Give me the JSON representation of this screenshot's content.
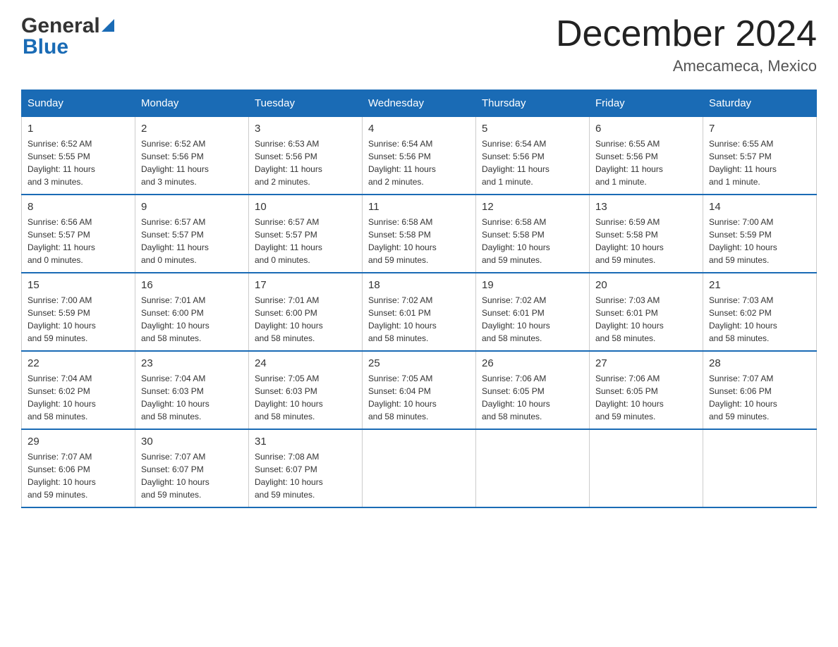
{
  "header": {
    "month_title": "December 2024",
    "location": "Amecameca, Mexico",
    "logo_general": "General",
    "logo_blue": "Blue"
  },
  "days_of_week": [
    "Sunday",
    "Monday",
    "Tuesday",
    "Wednesday",
    "Thursday",
    "Friday",
    "Saturday"
  ],
  "weeks": [
    [
      {
        "day": "1",
        "sunrise": "6:52 AM",
        "sunset": "5:55 PM",
        "daylight": "11 hours and 3 minutes."
      },
      {
        "day": "2",
        "sunrise": "6:52 AM",
        "sunset": "5:56 PM",
        "daylight": "11 hours and 3 minutes."
      },
      {
        "day": "3",
        "sunrise": "6:53 AM",
        "sunset": "5:56 PM",
        "daylight": "11 hours and 2 minutes."
      },
      {
        "day": "4",
        "sunrise": "6:54 AM",
        "sunset": "5:56 PM",
        "daylight": "11 hours and 2 minutes."
      },
      {
        "day": "5",
        "sunrise": "6:54 AM",
        "sunset": "5:56 PM",
        "daylight": "11 hours and 1 minute."
      },
      {
        "day": "6",
        "sunrise": "6:55 AM",
        "sunset": "5:56 PM",
        "daylight": "11 hours and 1 minute."
      },
      {
        "day": "7",
        "sunrise": "6:55 AM",
        "sunset": "5:57 PM",
        "daylight": "11 hours and 1 minute."
      }
    ],
    [
      {
        "day": "8",
        "sunrise": "6:56 AM",
        "sunset": "5:57 PM",
        "daylight": "11 hours and 0 minutes."
      },
      {
        "day": "9",
        "sunrise": "6:57 AM",
        "sunset": "5:57 PM",
        "daylight": "11 hours and 0 minutes."
      },
      {
        "day": "10",
        "sunrise": "6:57 AM",
        "sunset": "5:57 PM",
        "daylight": "11 hours and 0 minutes."
      },
      {
        "day": "11",
        "sunrise": "6:58 AM",
        "sunset": "5:58 PM",
        "daylight": "10 hours and 59 minutes."
      },
      {
        "day": "12",
        "sunrise": "6:58 AM",
        "sunset": "5:58 PM",
        "daylight": "10 hours and 59 minutes."
      },
      {
        "day": "13",
        "sunrise": "6:59 AM",
        "sunset": "5:58 PM",
        "daylight": "10 hours and 59 minutes."
      },
      {
        "day": "14",
        "sunrise": "7:00 AM",
        "sunset": "5:59 PM",
        "daylight": "10 hours and 59 minutes."
      }
    ],
    [
      {
        "day": "15",
        "sunrise": "7:00 AM",
        "sunset": "5:59 PM",
        "daylight": "10 hours and 59 minutes."
      },
      {
        "day": "16",
        "sunrise": "7:01 AM",
        "sunset": "6:00 PM",
        "daylight": "10 hours and 58 minutes."
      },
      {
        "day": "17",
        "sunrise": "7:01 AM",
        "sunset": "6:00 PM",
        "daylight": "10 hours and 58 minutes."
      },
      {
        "day": "18",
        "sunrise": "7:02 AM",
        "sunset": "6:01 PM",
        "daylight": "10 hours and 58 minutes."
      },
      {
        "day": "19",
        "sunrise": "7:02 AM",
        "sunset": "6:01 PM",
        "daylight": "10 hours and 58 minutes."
      },
      {
        "day": "20",
        "sunrise": "7:03 AM",
        "sunset": "6:01 PM",
        "daylight": "10 hours and 58 minutes."
      },
      {
        "day": "21",
        "sunrise": "7:03 AM",
        "sunset": "6:02 PM",
        "daylight": "10 hours and 58 minutes."
      }
    ],
    [
      {
        "day": "22",
        "sunrise": "7:04 AM",
        "sunset": "6:02 PM",
        "daylight": "10 hours and 58 minutes."
      },
      {
        "day": "23",
        "sunrise": "7:04 AM",
        "sunset": "6:03 PM",
        "daylight": "10 hours and 58 minutes."
      },
      {
        "day": "24",
        "sunrise": "7:05 AM",
        "sunset": "6:03 PM",
        "daylight": "10 hours and 58 minutes."
      },
      {
        "day": "25",
        "sunrise": "7:05 AM",
        "sunset": "6:04 PM",
        "daylight": "10 hours and 58 minutes."
      },
      {
        "day": "26",
        "sunrise": "7:06 AM",
        "sunset": "6:05 PM",
        "daylight": "10 hours and 58 minutes."
      },
      {
        "day": "27",
        "sunrise": "7:06 AM",
        "sunset": "6:05 PM",
        "daylight": "10 hours and 59 minutes."
      },
      {
        "day": "28",
        "sunrise": "7:07 AM",
        "sunset": "6:06 PM",
        "daylight": "10 hours and 59 minutes."
      }
    ],
    [
      {
        "day": "29",
        "sunrise": "7:07 AM",
        "sunset": "6:06 PM",
        "daylight": "10 hours and 59 minutes."
      },
      {
        "day": "30",
        "sunrise": "7:07 AM",
        "sunset": "6:07 PM",
        "daylight": "10 hours and 59 minutes."
      },
      {
        "day": "31",
        "sunrise": "7:08 AM",
        "sunset": "6:07 PM",
        "daylight": "10 hours and 59 minutes."
      },
      null,
      null,
      null,
      null
    ]
  ],
  "labels": {
    "sunrise": "Sunrise:",
    "sunset": "Sunset:",
    "daylight": "Daylight:"
  }
}
